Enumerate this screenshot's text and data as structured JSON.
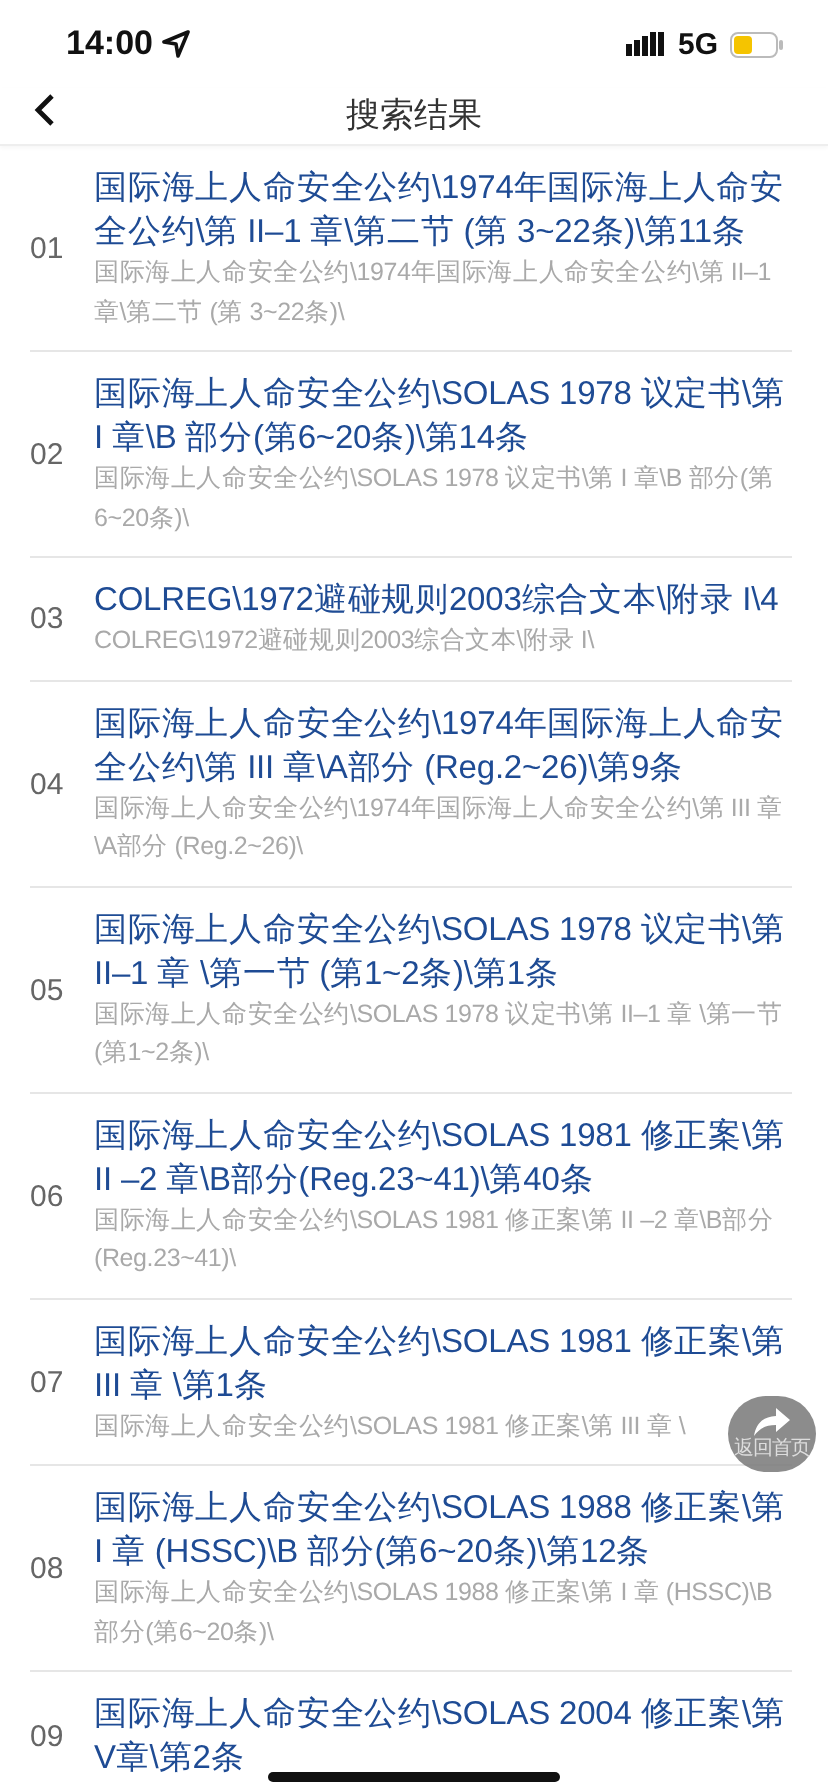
{
  "status_bar": {
    "time": "14:00",
    "network": "5G"
  },
  "nav_bar": {
    "title": "搜索结果"
  },
  "results": [
    {
      "index": "01",
      "title": "国际海上人命安全公约\\1974年国际海上人命安全公约\\第 II–1 章\\第二节 (第 3~22条)\\第11条",
      "path": "国际海上人命安全公约\\1974年国际海上人命安全公约\\第 II–1 章\\第二节 (第 3~22条)\\"
    },
    {
      "index": "02",
      "title": "国际海上人命安全公约\\SOLAS 1978 议定书\\第 I 章\\B 部分(第6~20条)\\第14条",
      "path": "国际海上人命安全公约\\SOLAS 1978 议定书\\第 I 章\\B 部分(第6~20条)\\"
    },
    {
      "index": "03",
      "title": "COLREG\\1972避碰规则2003综合文本\\附录 I\\4",
      "path": "COLREG\\1972避碰规则2003综合文本\\附录 I\\"
    },
    {
      "index": "04",
      "title": "国际海上人命安全公约\\1974年国际海上人命安全公约\\第 III 章\\A部分 (Reg.2~26)\\第9条",
      "path": "国际海上人命安全公约\\1974年国际海上人命安全公约\\第 III 章\\A部分 (Reg.2~26)\\"
    },
    {
      "index": "05",
      "title": "国际海上人命安全公约\\SOLAS 1978 议定书\\第 II–1 章 \\第一节 (第1~2条)\\第1条",
      "path": "国际海上人命安全公约\\SOLAS 1978 议定书\\第 II–1 章 \\第一节 (第1~2条)\\"
    },
    {
      "index": "06",
      "title": "国际海上人命安全公约\\SOLAS 1981 修正案\\第 II –2 章\\B部分(Reg.23~41)\\第40条",
      "path": "国际海上人命安全公约\\SOLAS 1981 修正案\\第 II –2 章\\B部分(Reg.23~41)\\"
    },
    {
      "index": "07",
      "title": "国际海上人命安全公约\\SOLAS 1981 修正案\\第 III 章 \\第1条",
      "path": "国际海上人命安全公约\\SOLAS 1981 修正案\\第 III 章 \\"
    },
    {
      "index": "08",
      "title": "国际海上人命安全公约\\SOLAS 1988 修正案\\第 I 章 (HSSC)\\B 部分(第6~20条)\\第12条",
      "path": "国际海上人命安全公约\\SOLAS 1988 修正案\\第 I 章 (HSSC)\\B 部分(第6~20条)\\"
    },
    {
      "index": "09",
      "title": "国际海上人命安全公约\\SOLAS 2004 修正案\\第 V章\\第2条"
    }
  ],
  "home_button": {
    "label": "返回首页"
  }
}
